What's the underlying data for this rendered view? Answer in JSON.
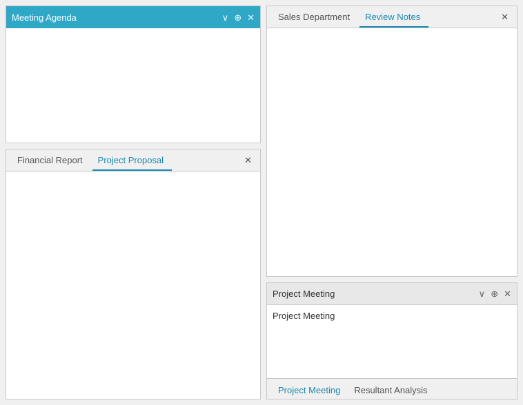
{
  "meetingAgenda": {
    "title": "Meeting Agenda",
    "controls": {
      "collapse": "∨",
      "pin": "⊕",
      "close": "✕"
    }
  },
  "bottomTabbedPanel": {
    "tabs": [
      {
        "label": "Financial Report",
        "active": false
      },
      {
        "label": "Project Proposal",
        "active": true
      }
    ],
    "close": "✕"
  },
  "topTabbedPanel": {
    "tabs": [
      {
        "label": "Sales Department",
        "active": false
      },
      {
        "label": "Review Notes",
        "active": true
      }
    ],
    "close": "✕"
  },
  "projectMeetingPanel": {
    "title": "Project Meeting",
    "bodyText": "Project Meeting",
    "controls": {
      "collapse": "∨",
      "pin": "⊕",
      "close": "✕"
    },
    "bottomTabs": [
      {
        "label": "Project Meeting",
        "active": true
      },
      {
        "label": "Resultant Analysis",
        "active": false
      }
    ]
  }
}
